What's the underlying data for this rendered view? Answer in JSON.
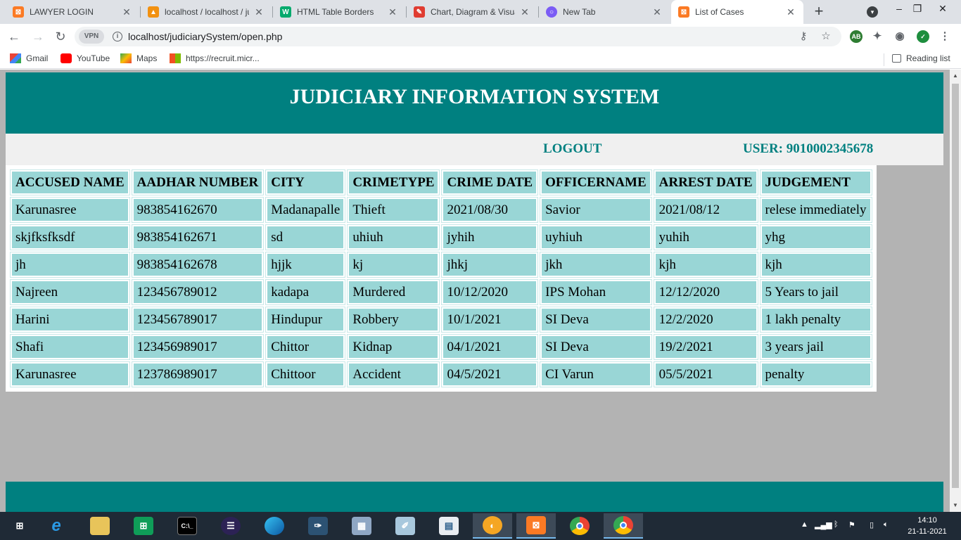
{
  "browser": {
    "tabs": [
      {
        "title": "LAWYER LOGIN",
        "icon": "xampp-icon",
        "color": "#fb7a24"
      },
      {
        "title": "localhost / localhost / ju",
        "icon": "phpmyadmin-icon",
        "color": "#f29111"
      },
      {
        "title": "HTML Table Borders",
        "icon": "w3schools-icon",
        "color": "#04aa6d"
      },
      {
        "title": "Chart, Diagram & Visua",
        "icon": "chart-icon",
        "color": "#e03c31"
      },
      {
        "title": "New Tab",
        "icon": "newtab-icon",
        "color": "#7b5cf5"
      },
      {
        "title": "List of Cases",
        "icon": "xampp-icon",
        "color": "#fb7a24"
      }
    ],
    "url": "localhost/judiciarySystem/open.php",
    "vpn_label": "VPN",
    "bookmarks": [
      {
        "label": "Gmail",
        "icon": "gmail-icon"
      },
      {
        "label": "YouTube",
        "icon": "youtube-icon"
      },
      {
        "label": "Maps",
        "icon": "maps-icon"
      },
      {
        "label": "https://recruit.micr...",
        "icon": "microsoft-icon"
      }
    ],
    "reading_list": "Reading list"
  },
  "page": {
    "title": "JUDICIARY INFORMATION SYSTEM",
    "logout_label": "LOGOUT",
    "user_label": "USER: 9010002345678",
    "colors": {
      "header": "#008080",
      "cell": "#99d6d6",
      "background": "#b3b3b3"
    }
  },
  "table": {
    "headers": [
      "ACCUSED NAME",
      "AADHAR NUMBER",
      "CITY",
      "CRIMETYPE",
      "CRIME DATE",
      "OFFICERNAME",
      "ARREST DATE",
      "JUDGEMENT"
    ],
    "rows": [
      [
        "Karunasree",
        "983854162670",
        "Madanapalle",
        "Thieft",
        "2021/08/30",
        "Savior",
        "2021/08/12",
        "relese immediately"
      ],
      [
        "skjfksfksdf",
        "983854162671",
        "sd",
        "uhiuh",
        "jyhih",
        "uyhiuh",
        "yuhih",
        "yhg"
      ],
      [
        "jh",
        "983854162678",
        "hjjk",
        "kj",
        "jhkj",
        "jkh",
        "kjh",
        "kjh"
      ],
      [
        "Najreen",
        "123456789012",
        "kadapa",
        "Murdered",
        "10/12/2020",
        "IPS Mohan",
        "12/12/2020",
        "5 Years to jail"
      ],
      [
        "Harini",
        "123456789017",
        "Hindupur",
        "Robbery",
        "10/1/2021",
        "SI Deva",
        "12/2/2020",
        "1 lakh penalty"
      ],
      [
        "Shafi",
        "123456989017",
        "Chittor",
        "Kidnap",
        "04/1/2021",
        "SI Deva",
        "19/2/2021",
        "3 years jail"
      ],
      [
        "Karunasree",
        "123786989017",
        "Chittoor",
        "Accident",
        "04/5/2021",
        "CI Varun",
        "05/5/2021",
        "penalty"
      ]
    ]
  },
  "taskbar": {
    "items": [
      "start-icon",
      "ie-icon",
      "file-explorer-icon",
      "store-icon",
      "cmd-icon",
      "eclipse-icon",
      "edge-icon",
      "mysql-icon",
      "calculator-icon",
      "notes-icon",
      "news-icon",
      "browser-icon",
      "xampp-icon",
      "chrome-icon",
      "chrome-profile-icon"
    ],
    "time": "14:10",
    "date": "21-11-2021"
  }
}
